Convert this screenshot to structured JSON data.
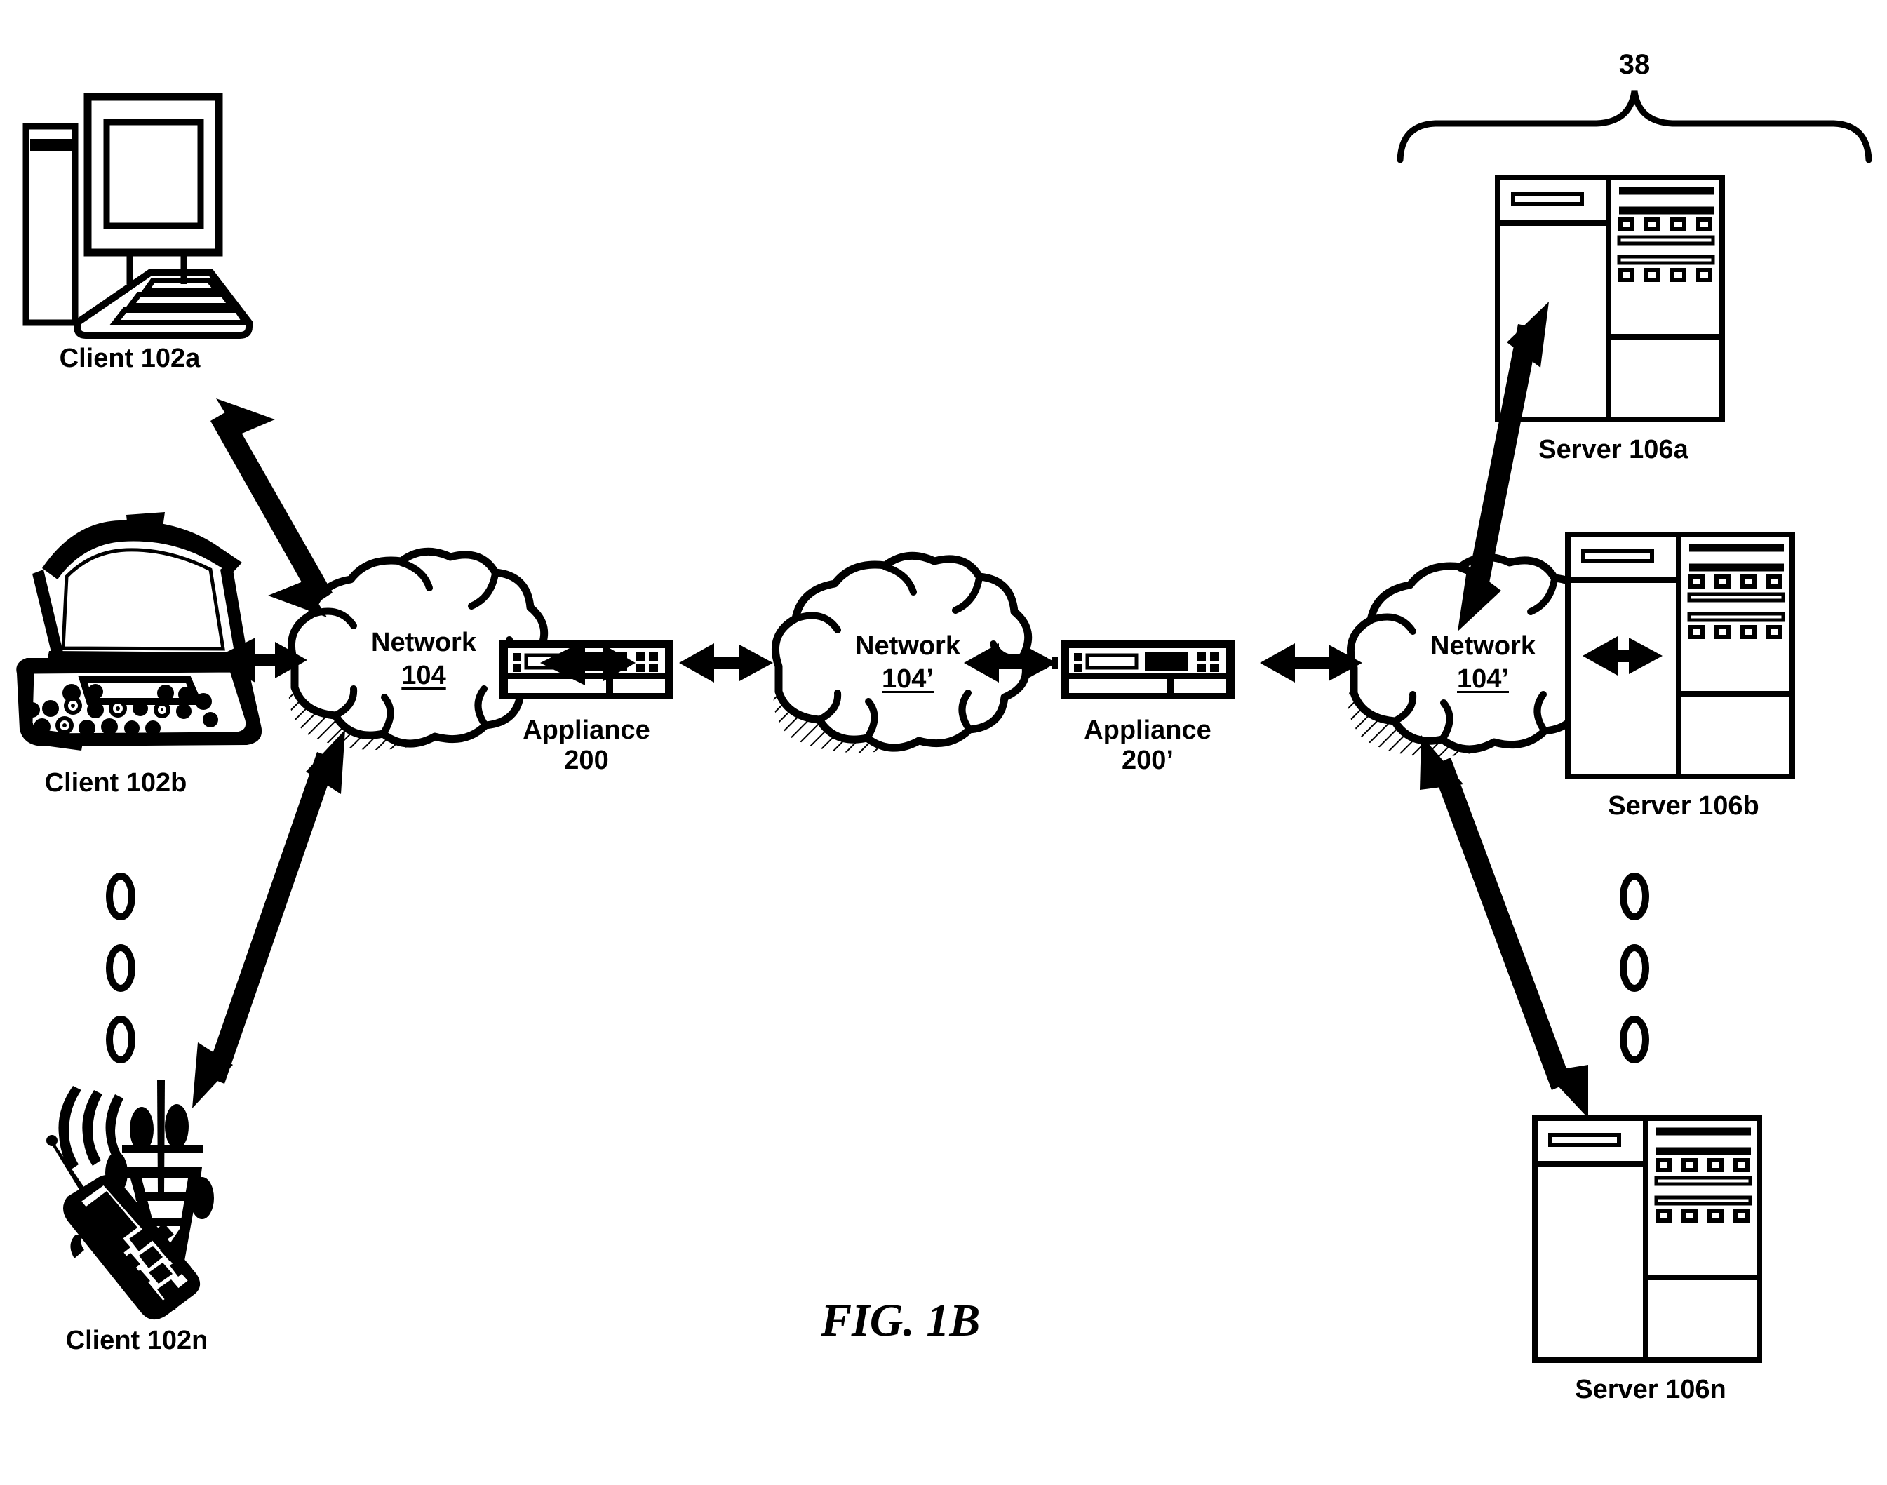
{
  "figure": {
    "caption": "FIG. 1B",
    "bracket_ref": "38"
  },
  "clients": [
    {
      "id": "client-102a",
      "label": "Client 102a",
      "icon": "desktop-computer-icon"
    },
    {
      "id": "client-102b",
      "label": "Client 102b",
      "icon": "laptop-computer-icon"
    },
    {
      "id": "client-102n",
      "label": "Client 102n",
      "icon": "mobile-phone-tower-icon"
    }
  ],
  "client_ellipsis": "⋮",
  "networks": [
    {
      "id": "network-104",
      "name": "Network",
      "ref": "104",
      "icon": "cloud-icon"
    },
    {
      "id": "network-104-prime-middle",
      "name": "Network",
      "ref": "104’",
      "icon": "cloud-icon"
    },
    {
      "id": "network-104-prime-right",
      "name": "Network",
      "ref": "104’",
      "icon": "cloud-icon"
    }
  ],
  "appliances": [
    {
      "id": "appliance-200",
      "name": "Appliance",
      "ref": "200",
      "icon": "appliance-icon"
    },
    {
      "id": "appliance-200-prime",
      "name": "Appliance",
      "ref": "200’",
      "icon": "appliance-icon"
    }
  ],
  "servers": [
    {
      "id": "server-106a",
      "label": "Server 106a",
      "icon": "server-rack-icon"
    },
    {
      "id": "server-106b",
      "label": "Server 106b",
      "icon": "server-rack-icon"
    },
    {
      "id": "server-106n",
      "label": "Server 106n",
      "icon": "server-rack-icon"
    }
  ],
  "server_ellipsis": "⋮",
  "colors": {
    "stroke": "#000000",
    "background": "#ffffff"
  }
}
